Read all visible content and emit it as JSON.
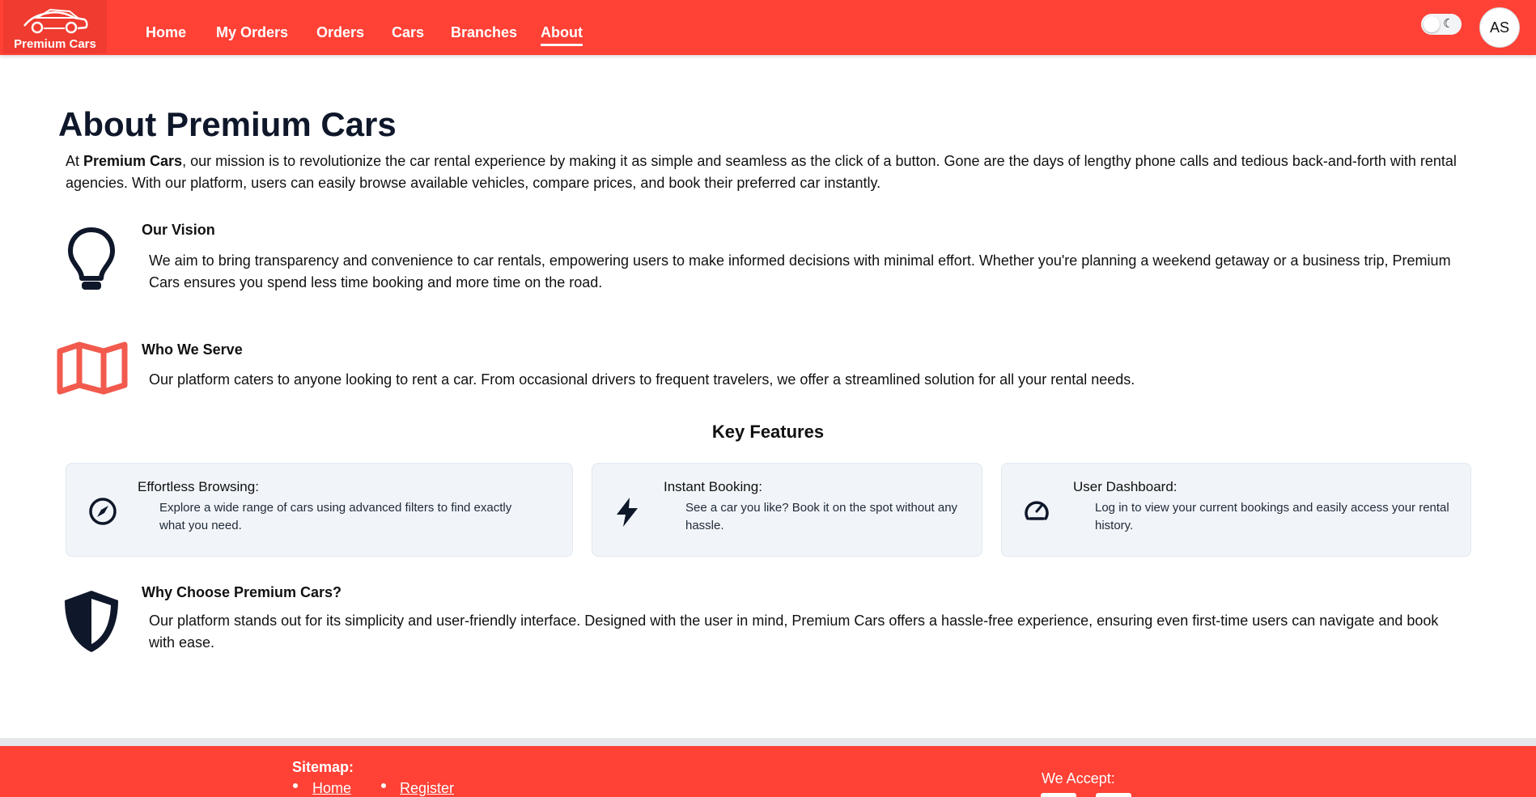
{
  "nav": {
    "logo_text": "Premium Cars",
    "links": [
      "Home",
      "My Orders",
      "Orders",
      "Cars",
      "Branches",
      "About"
    ],
    "active": "About",
    "avatar_initials": "AS"
  },
  "main": {
    "title": "About Premium Cars",
    "intro_prefix": "At ",
    "intro_brand": "Premium Cars",
    "intro_rest": ", our mission is to revolutionize the car rental experience by making it as simple and seamless as the click of a button. Gone are the days of lengthy phone calls and tedious back-and-forth with rental agencies. With our platform, users can easily browse available vehicles, compare prices, and book their preferred car instantly.",
    "sections": [
      {
        "icon": "lightbulb-icon",
        "title": "Our Vision",
        "text": "We aim to bring transparency and convenience to car rentals, empowering users to make informed decisions with minimal effort. Whether you're planning a weekend getaway or a business trip, Premium Cars ensures you spend less time booking and more time on the road."
      },
      {
        "icon": "map-icon",
        "title": "Who We Serve",
        "text": "Our platform caters to anyone looking to rent a car. From occasional drivers to frequent travelers, we offer a streamlined solution for all your rental needs."
      },
      {
        "icon": "shield-icon",
        "title": "Why Choose Premium Cars?",
        "text": "Our platform stands out for its simplicity and user-friendly interface. Designed with the user in mind, Premium Cars offers a hassle-free experience, ensuring even first-time users can navigate and book with ease."
      }
    ],
    "features_title": "Key Features",
    "features": [
      {
        "icon": "compass-icon",
        "title": "Effortless Browsing:",
        "text": "Explore a wide range of cars using advanced filters to find exactly what you need."
      },
      {
        "icon": "lightning-bolt-icon",
        "title": "Instant Booking:",
        "text": "See a car you like? Book it on the spot without any hassle."
      },
      {
        "icon": "speedometer-icon",
        "title": "User Dashboard:",
        "text": "Log in to view your current bookings and easily access your rental history."
      }
    ]
  },
  "footer": {
    "sitemap_label": "Sitemap:",
    "links": [
      "Home",
      "Register"
    ],
    "accept_label": "We Accept:"
  },
  "colors": {
    "brand": "#ff4136",
    "map_icon": "#f25a4d",
    "dark": "#0f172a"
  }
}
